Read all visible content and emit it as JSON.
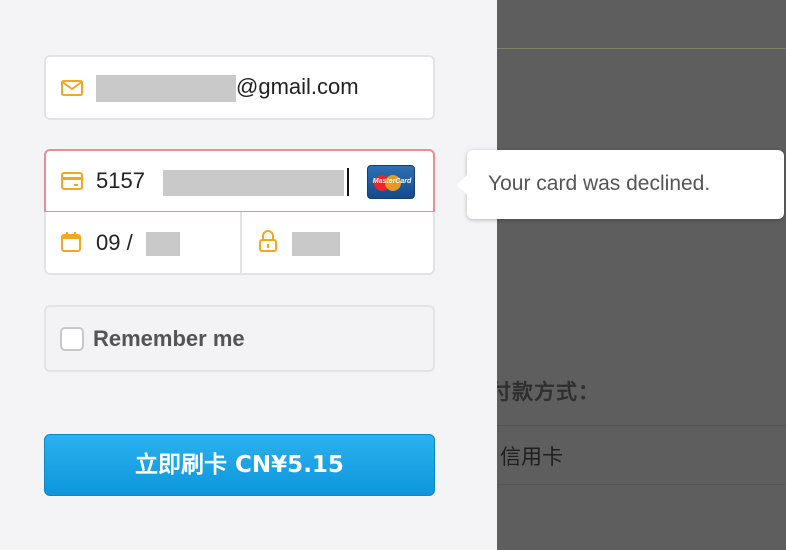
{
  "background": {
    "heading": "付款方式：",
    "option": "信用卡"
  },
  "checkout": {
    "email": {
      "suffix": "@gmail.com",
      "icon": "mail-icon"
    },
    "card": {
      "number_prefix": "5157",
      "brand": "MasterCard",
      "icon": "credit-card-icon"
    },
    "expiry": {
      "month_text": "09 /",
      "icon": "calendar-icon"
    },
    "cvc": {
      "icon": "lock-icon"
    },
    "remember": {
      "label": "Remember me"
    },
    "pay_button": {
      "label": "立即刷卡 CN¥5.15"
    },
    "error_tooltip": {
      "message": "Your card was declined."
    }
  },
  "colors": {
    "accent": "#f5a623",
    "error_border": "#f08a93",
    "button": "#1aa3e6"
  }
}
